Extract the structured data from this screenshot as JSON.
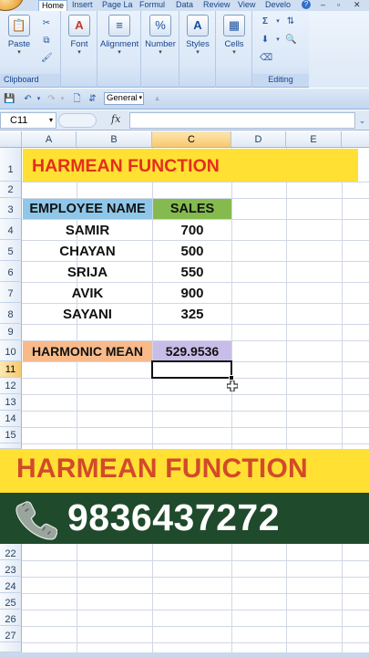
{
  "ribbon": {
    "tabs": [
      "Home",
      "Insert",
      "Page La",
      "Formul",
      "Data",
      "Review",
      "View",
      "Develo"
    ],
    "groups": {
      "clipboard": {
        "label": "Clipboard",
        "paste": "Paste"
      },
      "font": {
        "label": "Font"
      },
      "alignment": {
        "label": "Alignment"
      },
      "number": {
        "label": "Number"
      },
      "styles": {
        "label": "Styles"
      },
      "cells": {
        "label": "Cells"
      },
      "editing": {
        "label": "Editing"
      }
    }
  },
  "quick_access": {
    "number_format": "General"
  },
  "formula_bar": {
    "name_box": "C11",
    "fx": "fx",
    "formula": ""
  },
  "columns": [
    "A",
    "B",
    "C",
    "D",
    "E"
  ],
  "selected_column": "C",
  "rows_top": [
    "1",
    "2",
    "3",
    "4",
    "5",
    "6",
    "7",
    "8",
    "9",
    "10",
    "11",
    "12",
    "13",
    "14",
    "15"
  ],
  "rows_bottom": [
    "22",
    "23",
    "24",
    "25",
    "26",
    "27"
  ],
  "selected_row": "11",
  "sheet": {
    "title": "HARMEAN FUNCTION",
    "header_name": "EMPLOYEE NAME",
    "header_sales": "SALES",
    "employees": [
      {
        "name": "SAMIR",
        "sales": "700"
      },
      {
        "name": "CHAYAN",
        "sales": "500"
      },
      {
        "name": "SRIJA",
        "sales": "550"
      },
      {
        "name": "AVIK",
        "sales": "900"
      },
      {
        "name": "SAYANI",
        "sales": "325"
      }
    ],
    "result_label": "HARMONIC MEAN",
    "result_value": "529.9536"
  },
  "overlay": {
    "banner_title": "HARMEAN FUNCTION",
    "phone": "9836437272"
  },
  "colors": {
    "title_fill": "#ffe033",
    "title_text": "#e3301b",
    "header_blue": "#8fc7e9",
    "header_green": "#85bb4e",
    "label_orange": "#f8ba8a",
    "value_purple": "#c8bde8",
    "banner_green": "#1f4a2b"
  }
}
